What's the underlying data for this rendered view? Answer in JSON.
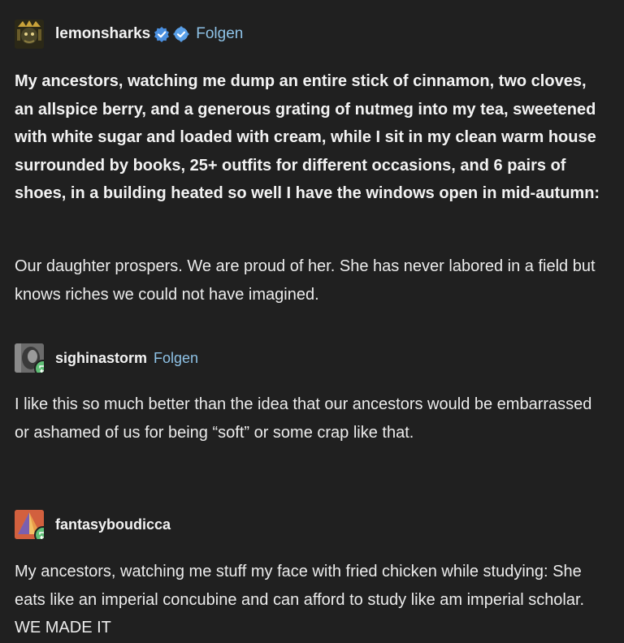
{
  "posts": [
    {
      "username": "lemonsharks",
      "verified_badges": [
        "check-badge-icon",
        "gear-check-badge-icon"
      ],
      "follow_label": "Folgen",
      "paragraphs": [
        "My ancestors, watching me dump an entire stick of cinnamon, two cloves, an allspice berry, and a generous grating of nutmeg into my tea, sweetened with white sugar and loaded with cream, while I sit in my clean warm house surrounded by books, 25+ outfits for different occasions, and 6 pairs of shoes, in a building heated so well I have the windows open in mid-autumn:",
        "Our daughter prospers. We are proud of her. She has never labored in a field but knows riches we could not have imagined."
      ]
    },
    {
      "username": "sighinastorm",
      "follow_label": "Folgen",
      "paragraphs": [
        "I like this so much better than the idea that our ancestors would be embarrassed or ashamed of us for being “soft” or some crap like that."
      ]
    },
    {
      "username": "fantasyboudicca",
      "paragraphs": [
        "My ancestors, watching me stuff my face with fried chicken while studying: She eats like an imperial concubine and can afford to study like am imperial scholar. WE MADE IT"
      ]
    }
  ],
  "colors": {
    "background": "#202020",
    "text": "#ebebeb",
    "follow_link": "#8ec2e6",
    "verified_blue": "#4a8fe0",
    "reblog_green": "#5fbf76"
  }
}
